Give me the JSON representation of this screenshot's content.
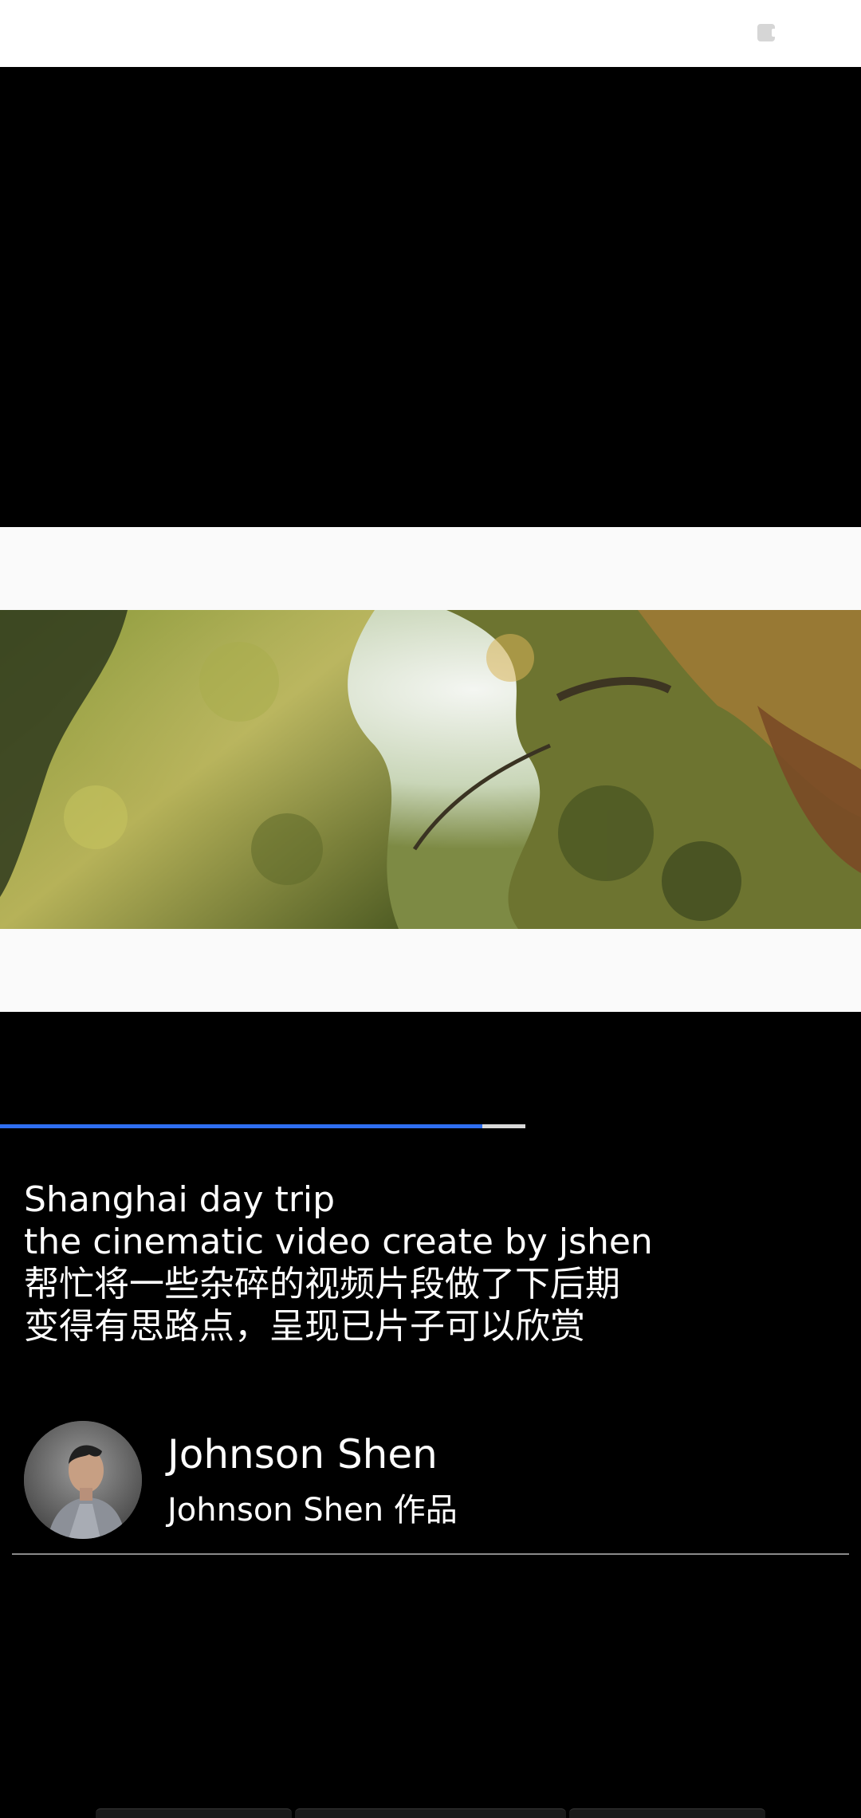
{
  "top_bar": {
    "icon": "cast-icon"
  },
  "video": {
    "progress": {
      "played_fraction": 0.56,
      "buffered_fraction": 0.61
    }
  },
  "description": {
    "lines": [
      "Shanghai day trip",
      "the cinematic video create by jshen",
      "帮忙将一些杂碎的视频片段做了下后期",
      "变得有思路点，呈现已片子可以欣赏"
    ]
  },
  "author": {
    "name": "Johnson Shen",
    "subtitle": "Johnson Shen 作品"
  },
  "colors": {
    "progress_played": "#2f6ff2",
    "progress_buffered": "#d9d9d9",
    "background": "#000000"
  }
}
